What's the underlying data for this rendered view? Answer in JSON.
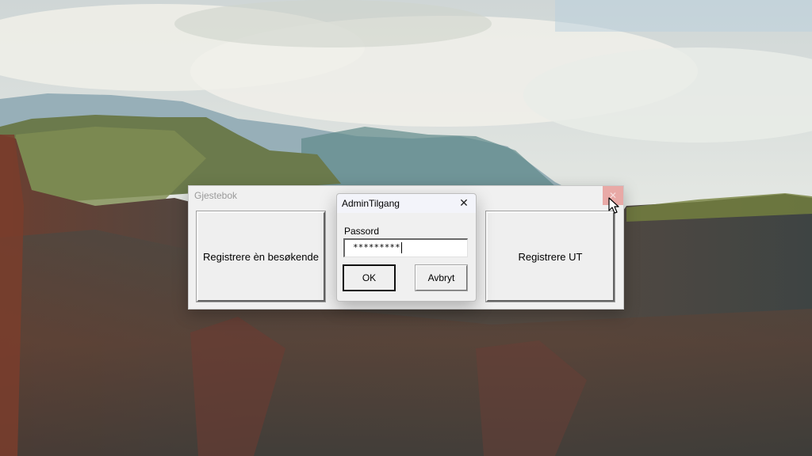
{
  "main_window": {
    "title": "Gjestebok",
    "close_glyph": "✕",
    "register_visitor_label": "Registrere èn besøkende",
    "register_out_label": "Registrere UT"
  },
  "input_dialog": {
    "title": "AdminTilgang",
    "close_glyph": "✕",
    "prompt_label": "Passord",
    "password_value": "*********",
    "ok_label": "OK",
    "cancel_label": "Avbryt"
  },
  "colors": {
    "window_bg": "#f0f0f0",
    "close_hover": "#e8a9a6",
    "dialog_title_bg": "#f3f4fa"
  },
  "icons": {
    "cursor": "arrow-cursor-icon",
    "close": "close-icon"
  }
}
